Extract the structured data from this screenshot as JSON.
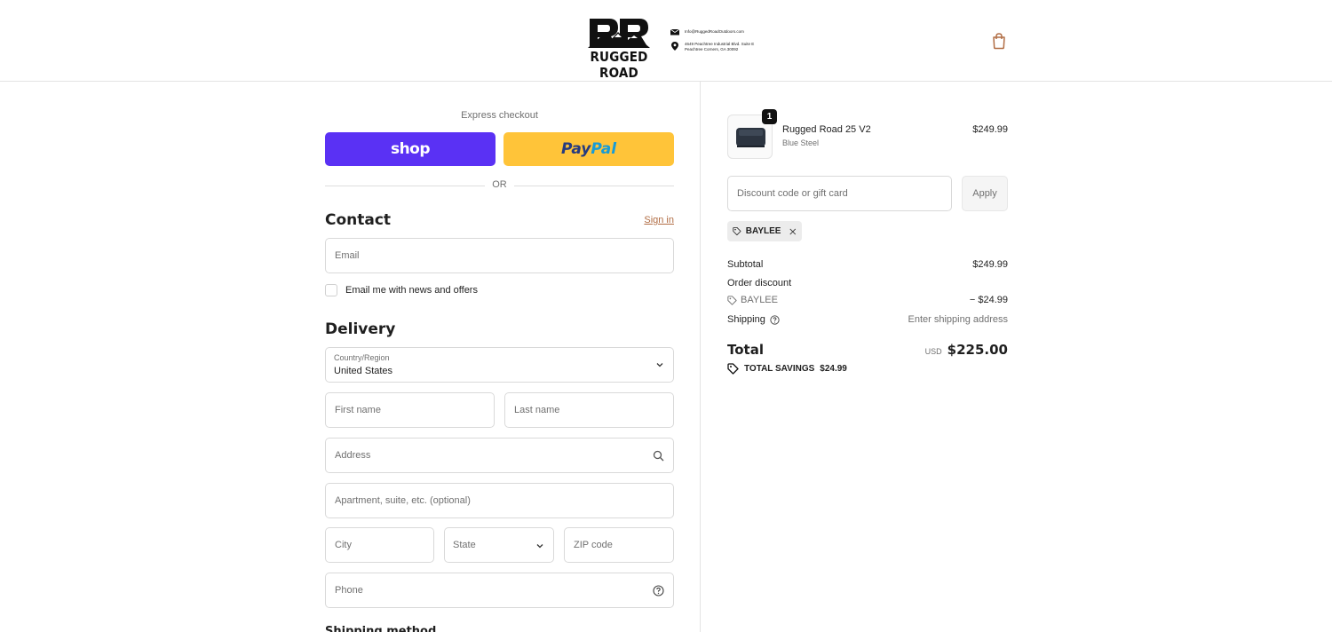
{
  "header": {
    "brand": "RUGGED ROAD",
    "email": "Info@RuggedRoadOutdoors.com",
    "address_line1": "4649 Peachtree Industrial Blvd. Suite E",
    "address_line2": "Peachtree Corners, GA 30092",
    "cart_icon": "shopping-bag-icon"
  },
  "express": {
    "title": "Express checkout",
    "shop_label": "shop",
    "paypal_part1": "Pay",
    "paypal_part2": "Pal",
    "or_label": "OR"
  },
  "contact": {
    "title": "Contact",
    "signin_label": "Sign in",
    "email_placeholder": "Email",
    "newsletter_label": "Email me with news and offers"
  },
  "delivery": {
    "title": "Delivery",
    "country_label": "Country/Region",
    "country_value": "United States",
    "first_name_placeholder": "First name",
    "last_name_placeholder": "Last name",
    "address_placeholder": "Address",
    "apartment_placeholder": "Apartment, suite, etc. (optional)",
    "city_placeholder": "City",
    "state_placeholder": "State",
    "zip_placeholder": "ZIP code",
    "phone_placeholder": "Phone"
  },
  "shipping_method_title": "Shipping method",
  "order": {
    "item": {
      "name": "Rugged Road 25 V2",
      "variant": "Blue Steel",
      "price": "$249.99",
      "quantity": "1"
    },
    "discount_placeholder": "Discount code or gift card",
    "apply_label": "Apply",
    "applied_code": "BAYLEE",
    "subtotal_label": "Subtotal",
    "subtotal_value": "$249.99",
    "order_discount_label": "Order discount",
    "discount_code": "BAYLEE",
    "discount_value": "− $24.99",
    "shipping_label": "Shipping",
    "shipping_value": "Enter shipping address",
    "total_label": "Total",
    "total_currency": "USD",
    "total_value": "$225.00",
    "savings_label": "TOTAL SAVINGS",
    "savings_value": "$24.99"
  },
  "colors": {
    "shop_pay": "#5a31f4",
    "paypal": "#ffc439",
    "link": "#b16d44"
  }
}
